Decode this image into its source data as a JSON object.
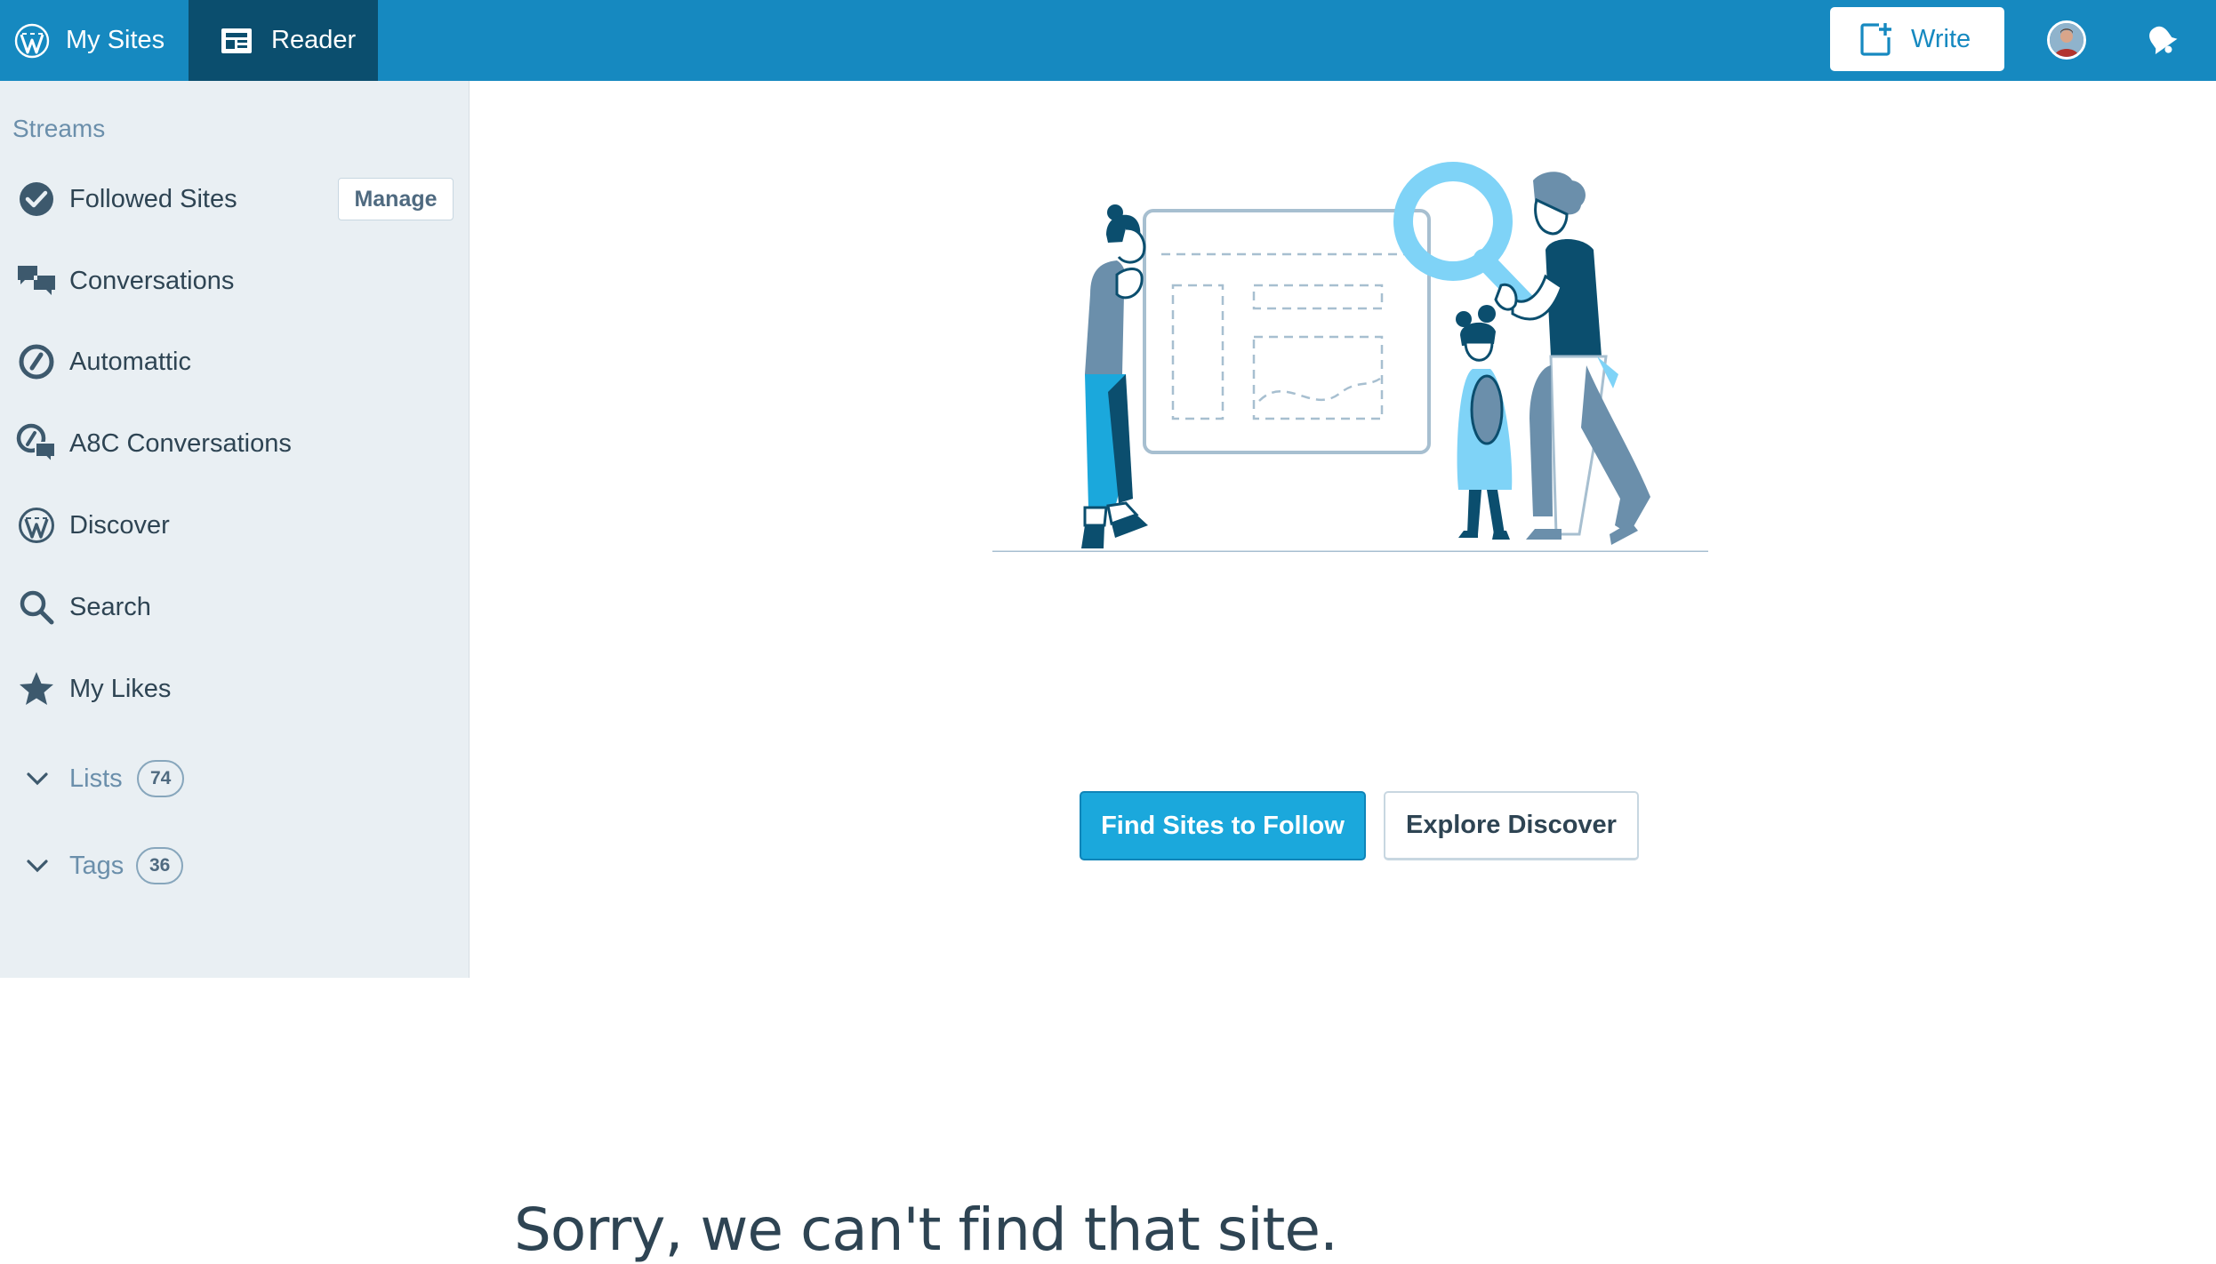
{
  "masterbar": {
    "my_sites_label": "My Sites",
    "reader_label": "Reader",
    "write_label": "Write",
    "icons": {
      "my_sites": "wordpress-logo-icon",
      "reader": "reader-icon",
      "write": "add-post-icon",
      "avatar": "user-avatar",
      "notifications": "bell-icon"
    }
  },
  "sidebar": {
    "heading": "Streams",
    "manage_label": "Manage",
    "items": [
      {
        "label": "Followed Sites",
        "icon": "checkmark-circle-icon"
      },
      {
        "label": "Conversations",
        "icon": "chat-bubbles-icon"
      },
      {
        "label": "Automattic",
        "icon": "automattic-logo-icon"
      },
      {
        "label": "A8C Conversations",
        "icon": "a8c-chat-icon"
      },
      {
        "label": "Discover",
        "icon": "wordpress-logo-icon"
      },
      {
        "label": "Search",
        "icon": "search-icon"
      },
      {
        "label": "My Likes",
        "icon": "star-icon"
      }
    ],
    "expandables": [
      {
        "label": "Lists",
        "count": "74"
      },
      {
        "label": "Tags",
        "count": "36"
      }
    ]
  },
  "main": {
    "headline": "Sorry, we can't find that site.",
    "primary_button": "Find Sites to Follow",
    "secondary_button": "Explore Discover"
  },
  "colors": {
    "masterbar": "#1689c0",
    "reader_active": "#0b4e6e",
    "sidebar_bg": "#e9eff3",
    "text_dark": "#2e4453",
    "text_muted": "#6b8fab",
    "primary_button": "#1ba8dc"
  }
}
